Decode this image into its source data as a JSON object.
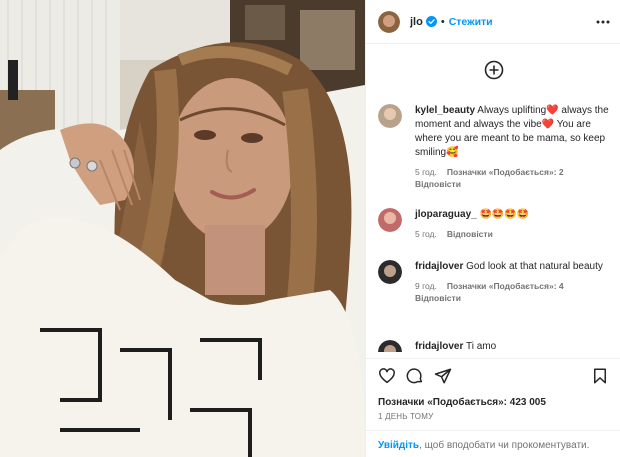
{
  "header": {
    "username": "jlo",
    "separator": "•",
    "follow_label": "Стежити"
  },
  "comments": [
    {
      "username": "kylel_beauty",
      "text": "Always uplifting❤️ always the moment and always the vibe❤️ You are where you are meant to be mama, so keep smiling🥰",
      "time": "5 год.",
      "likes": "Позначки «Подобається»: 2",
      "reply": "Відповісти"
    },
    {
      "username": "jloparaguay_",
      "text": "🤩🤩🤩🤩",
      "time": "5 год.",
      "likes": "",
      "reply": "Відповісти"
    },
    {
      "username": "fridajlover",
      "text": "God look at that natural beauty",
      "time": "9 год.",
      "likes": "Позначки «Подобається»: 4",
      "reply": "Відповісти"
    },
    {
      "username": "fridajlover",
      "text": "Ti amo",
      "time": "",
      "likes": "",
      "reply": ""
    }
  ],
  "footer": {
    "likes": "Позначки «Подобається»: 423 005",
    "posted": "1 ДЕНЬ ТОМУ",
    "login_link": "Увійдіть",
    "login_rest": ", щоб вподобати чи прокоментувати."
  },
  "icons": {
    "more": "more-options-icon",
    "add": "add-circle-icon",
    "like": "heart-icon",
    "comment": "comment-icon",
    "share": "share-icon",
    "save": "bookmark-icon",
    "verified": "verified-badge-icon"
  },
  "colors": {
    "accent": "#0095f6",
    "text": "#262626",
    "muted": "#737373",
    "divider": "#efefef"
  }
}
